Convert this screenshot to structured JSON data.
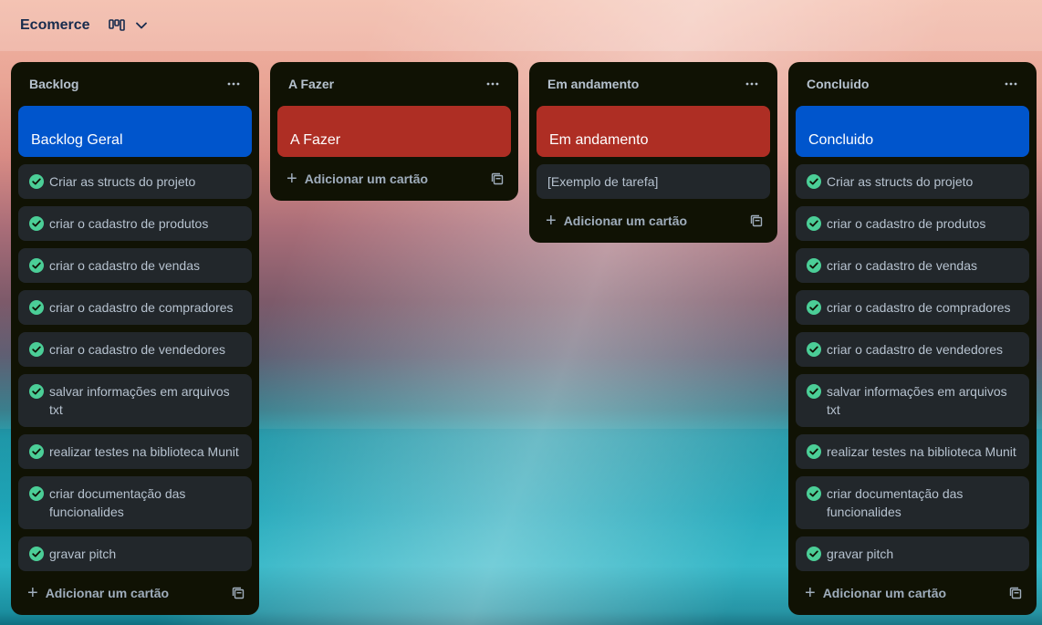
{
  "board": {
    "title": "Ecomerce",
    "view_icon": "board-view-icon",
    "chevron_icon": "chevron-down-icon"
  },
  "colors": {
    "list_bg": "#101204",
    "card_bg": "#22272b",
    "cover_blue": "#0055cc",
    "cover_red": "#ae2e24",
    "check_green": "#4bce97",
    "text": "#b6c2cf"
  },
  "add_card_label": "Adicionar um cartão",
  "lists": [
    {
      "title": "Backlog",
      "cover": {
        "label": "Backlog Geral",
        "color": "#0055cc"
      },
      "cards": [
        "Criar as structs do projeto",
        "criar o cadastro de produtos",
        "criar o cadastro de vendas",
        "criar o cadastro de compradores",
        "criar o cadastro de vendedores",
        "salvar informações em arquivos txt",
        "realizar testes na biblioteca Munit",
        "criar documentação das funcionalides",
        "gravar pitch"
      ],
      "cards_checked": true
    },
    {
      "title": "A Fazer",
      "cover": {
        "label": "A Fazer",
        "color": "#ae2e24"
      },
      "cards": [],
      "cards_checked": false
    },
    {
      "title": "Em andamento",
      "cover": {
        "label": "Em andamento",
        "color": "#ae2e24"
      },
      "cards": [
        "[Exemplo de tarefa]"
      ],
      "cards_checked": false
    },
    {
      "title": "Concluido",
      "cover": {
        "label": "Concluido",
        "color": "#0055cc"
      },
      "cards": [
        "Criar as structs do projeto",
        "criar o cadastro de produtos",
        "criar o cadastro de vendas",
        "criar o cadastro de compradores",
        "criar o cadastro de vendedores",
        "salvar informações em arquivos txt",
        "realizar testes na biblioteca Munit",
        "criar documentação das funcionalides",
        "gravar pitch"
      ],
      "cards_checked": true
    }
  ]
}
